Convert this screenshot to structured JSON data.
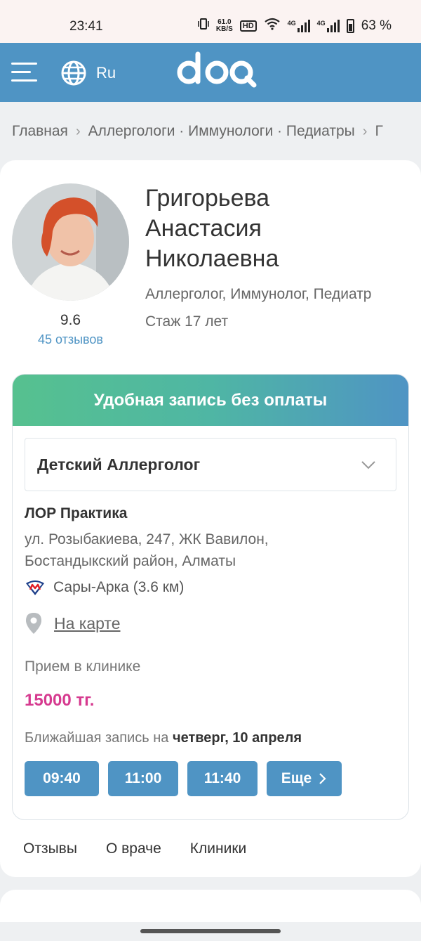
{
  "status_bar": {
    "time": "23:41",
    "net_speed_top": "61.0",
    "net_speed_bottom": "KB/S",
    "hd_label": "HD",
    "net1": "4G",
    "net2": "4G",
    "battery": "63 %"
  },
  "header": {
    "lang": "Ru",
    "logo": "doq"
  },
  "breadcrumb": {
    "items": [
      "Главная",
      "Аллергологи · Иммунологи · Педиатры",
      "Г"
    ]
  },
  "doctor": {
    "name_line1": "Григорьева",
    "name_line2": "Анастасия",
    "name_line3": "Николаевна",
    "specialties": "Аллерголог, Иммунолог, Педиатр",
    "experience": "Стаж 17 лет",
    "rating": "9.6",
    "reviews": "45 отзывов"
  },
  "booking": {
    "title": "Удобная запись без оплаты",
    "specialty_selected": "Детский Аллерголог",
    "clinic_name": "ЛОР Практика",
    "address_line1": "ул. Розыбакиева, 247, ЖК Вавилон,",
    "address_line2": "Бостандыкский район, Алматы",
    "metro": "Сары-Арка (3.6 км)",
    "map_link": "На карте",
    "visit_type": "Прием в клинике",
    "price": "15000 тг.",
    "nearest_prefix": "Ближайшая запись на",
    "nearest_date": "четверг, 10 апреля",
    "slots": [
      "09:40",
      "11:00",
      "11:40"
    ],
    "more_label": "Еще"
  },
  "tabs": [
    "Отзывы",
    "О враче",
    "Клиники"
  ],
  "colors": {
    "brand": "#4f94c4",
    "price": "#d63a8f",
    "gradient_start": "#56c18f"
  }
}
